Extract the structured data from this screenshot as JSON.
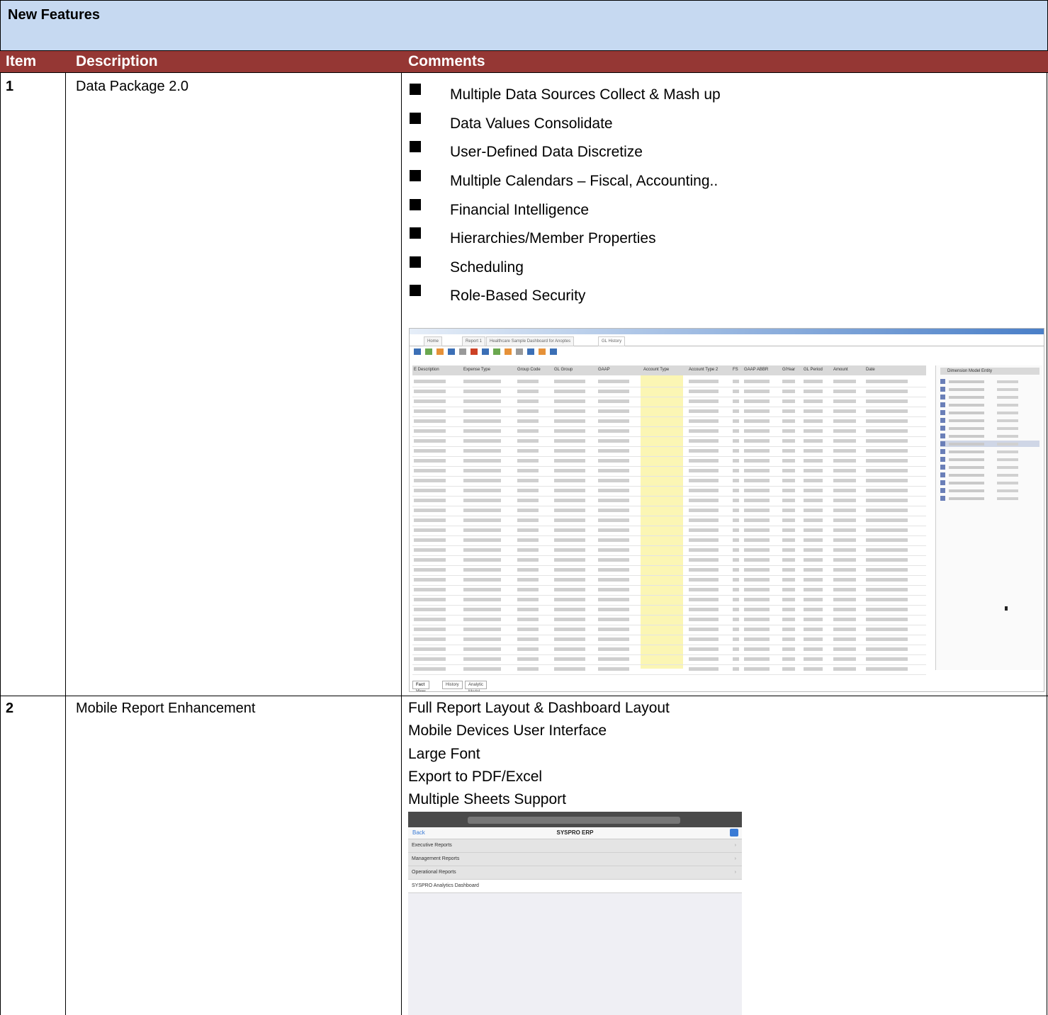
{
  "title": "New Features",
  "headers": {
    "item": "Item",
    "description": "Description",
    "comments": "Comments"
  },
  "rows": [
    {
      "item": "1",
      "description": "Data Package 2.0",
      "bullets": [
        "Multiple Data Sources Collect & Mash up",
        "Data Values Consolidate",
        "User-Defined Data Discretize",
        "Multiple Calendars – Fiscal, Accounting..",
        "Financial Intelligence",
        "Hierarchies/Member Properties",
        "Scheduling",
        "Role-Based Security"
      ]
    },
    {
      "item": "2",
      "description": "Mobile Report Enhancement",
      "lines": [
        "Full Report Layout & Dashboard Layout",
        "Mobile Devices User Interface",
        "Large Font",
        "Export to PDF/Excel",
        "Multiple Sheets Support"
      ]
    }
  ],
  "screenshot1": {
    "tabs": [
      "Home",
      "Report 1",
      "Healthcare Sample Dashboard for Anoptes",
      "GL History"
    ],
    "columns": [
      "E Description",
      "Expense Type",
      "Group Code",
      "GL Group",
      "GAAP",
      "Account Type",
      "Account Type 2",
      "FS",
      "GAAP ABBR",
      "GlYear",
      "GL Period",
      "Amount",
      "Date"
    ],
    "side_header": "Dimension Model Entity",
    "bottom_tabs": [
      "Fact View",
      "History",
      "Analytic Model"
    ]
  },
  "screenshot2": {
    "back": "Back",
    "title": "SYSPRO ERP",
    "items": [
      "Executive Reports",
      "Management Reports",
      "Operational Reports",
      "SYSPRO Analytics Dashboard"
    ]
  }
}
